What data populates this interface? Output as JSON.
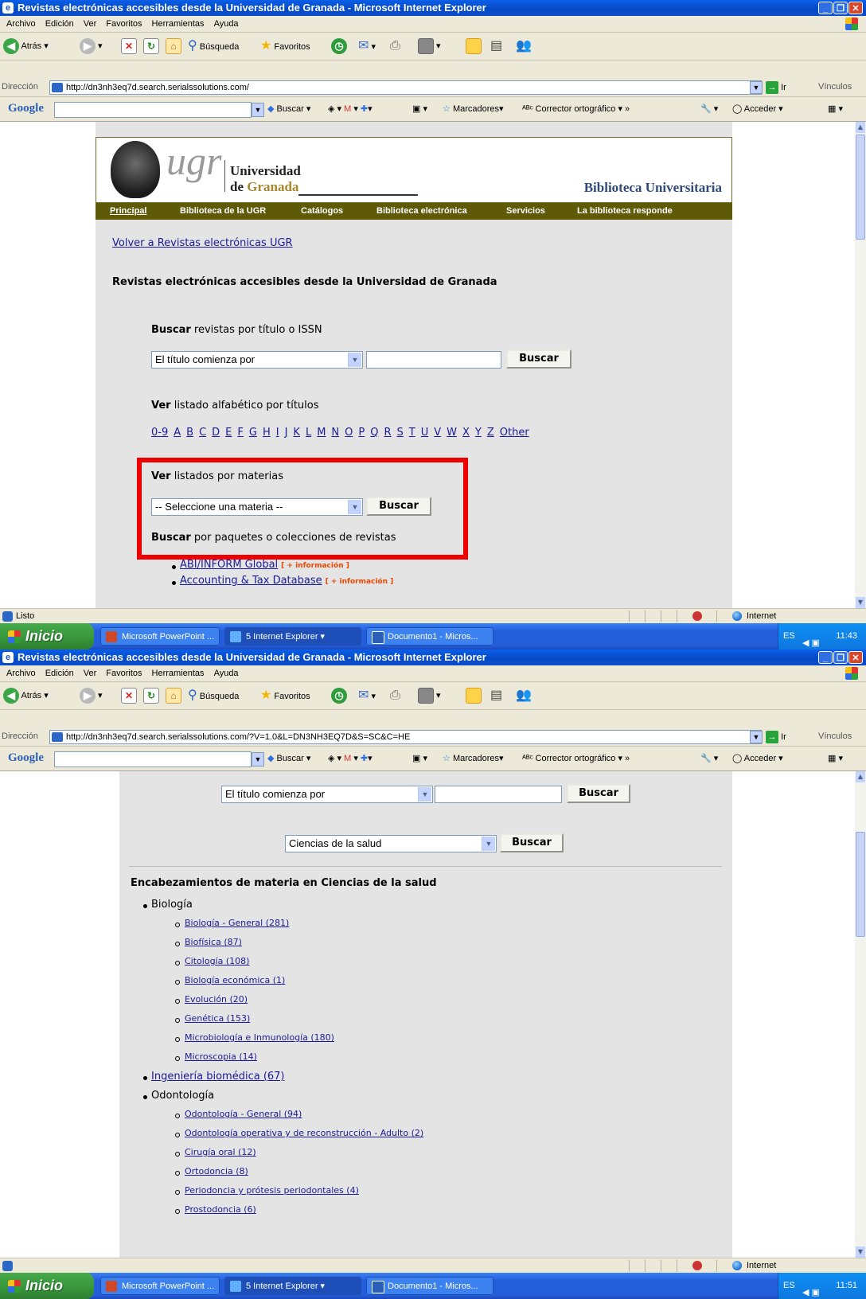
{
  "window": {
    "title": "Revistas electrónicas accesibles desde la Universidad de Granada - Microsoft Internet Explorer",
    "menu": [
      "Archivo",
      "Edición",
      "Ver",
      "Favoritos",
      "Herramientas",
      "Ayuda"
    ],
    "toolbar": {
      "back": "Atrás",
      "search": "Búsqueda",
      "favorites": "Favoritos"
    },
    "address_label": "Dirección",
    "go_label": "Ir",
    "links_label": "Vínculos",
    "google": {
      "logo": "Google",
      "search": "Buscar",
      "bookmarks": "Marcadores",
      "spell": "Corrector ortográfico",
      "signin": "Acceder"
    }
  },
  "shot1": {
    "url": "http://dn3nh3eq7d.search.serialssolutions.com/",
    "status": "Listo",
    "zone": "Internet",
    "clock": "11:43",
    "header": {
      "logo_text": "ugr",
      "name_line1": "Universidad",
      "name_de": "de",
      "name_granada": "Granada",
      "biblioteca": "Biblioteca Universitaria"
    },
    "nav": [
      "Principal",
      "Biblioteca de la UGR",
      "Catálogos",
      "Biblioteca electrónica",
      "Servicios",
      "La biblioteca responde"
    ],
    "back_link": "Volver a Revistas electrónicas UGR",
    "heading": "Revistas electrónicas accesibles desde la Universidad de Granada",
    "search_title_bold": "Buscar",
    "search_title_rest": " revistas por título o ISSN",
    "search_select": "El título comienza por",
    "search_button": "Buscar",
    "alpha_bold": "Ver",
    "alpha_rest": " listado alfabético por títulos",
    "letters": [
      "0-9",
      "A",
      "B",
      "C",
      "D",
      "E",
      "F",
      "G",
      "H",
      "I",
      "J",
      "K",
      "L",
      "M",
      "N",
      "O",
      "P",
      "Q",
      "R",
      "S",
      "T",
      "U",
      "V",
      "W",
      "X",
      "Y",
      "Z",
      "Other"
    ],
    "subject_bold": "Ver",
    "subject_rest": " listados por materias",
    "subject_select": "-- Seleccione una materia --",
    "subject_button": "Buscar",
    "packages_bold": "Buscar",
    "packages_rest": " por paquetes o colecciones de revistas",
    "packages": [
      {
        "name": "ABI/INFORM Global",
        "info": "[ + información ]"
      },
      {
        "name": "Accounting & Tax Database",
        "info": "[ + información ]"
      }
    ]
  },
  "shot2": {
    "url": "http://dn3nh3eq7d.search.serialssolutions.com/?V=1.0&L=DN3NH3EQ7D&S=SC&C=HE",
    "zone": "Internet",
    "clock": "11:51",
    "search_select": "El título comienza por",
    "search_button": "Buscar",
    "subject_select": "Ciencias de la salud",
    "subject_button": "Buscar",
    "heading": "Encabezamientos de materia en Ciencias de la salud",
    "tree": [
      {
        "label": "Biología",
        "link": false,
        "children": [
          "Biología - General (281)",
          "Biofísica (87)",
          "Citología (108)",
          "Biología económica (1)",
          "Evolución (20)",
          "Genética (153)",
          "Microbiología e Inmunología (180)",
          "Microscopia (14)"
        ]
      },
      {
        "label": "Ingeniería biomédica (67)",
        "link": true,
        "children": []
      },
      {
        "label": "Odontología",
        "link": false,
        "children": [
          "Odontología - General (94)",
          "Odontología operativa y de reconstrucción - Adulto (2)",
          "Cirugía oral (12)",
          "Ortodoncia (8)",
          "Periodoncia y prótesis periodontales (4)",
          "Prostodoncia (6)"
        ]
      }
    ]
  },
  "taskbar": {
    "start": "Inicio",
    "items": [
      "Microsoft PowerPoint ...",
      "5 Internet Explorer",
      "Documento1 - Micros..."
    ],
    "lang": "ES"
  }
}
